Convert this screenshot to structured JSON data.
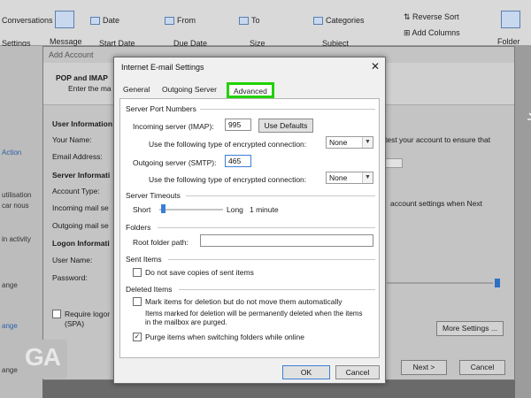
{
  "ribbon": {
    "items": [
      "Conversations",
      "Settings",
      "Message",
      "Date",
      "From",
      "To",
      "Categories",
      "Reverse Sort",
      "Add Columns",
      "Start Date",
      "Due Date",
      "Size",
      "Subject",
      "Folder"
    ]
  },
  "left_pane": {
    "items": [
      "Action",
      "utilisation",
      "car nous",
      "in activity",
      "ange",
      "ange",
      "ange"
    ]
  },
  "add_account": {
    "title": "Add Account",
    "header_title": "POP and IMAP",
    "header_sub": "Enter the ma",
    "user_info": "User Information",
    "your_name": "Your Name:",
    "email": "Email Address:",
    "server_info": "Server Informati",
    "account_type": "Account Type:",
    "incoming": "Incoming mail se",
    "outgoing": "Outgoing mail se",
    "logon_info": "Logon Informati",
    "user_name": "User Name:",
    "password": "Password:",
    "require_logon": "Require logor",
    "spa": "(SPA)",
    "test_text": "test your account to ensure that",
    "settings_text": "account settings when Next",
    "more_settings": "More Settings ...",
    "next": "Next >",
    "cancel": "Cancel"
  },
  "dialog": {
    "title": "Internet E-mail Settings",
    "close": "✕",
    "tabs": [
      "General",
      "Outgoing Server",
      "Advanced"
    ],
    "server_port_numbers": "Server Port Numbers",
    "incoming_label": "Incoming server (IMAP):",
    "incoming_value": "995",
    "use_defaults": "Use Defaults",
    "encrypt_label_1": "Use the following type of encrypted connection:",
    "encrypt_value_1": "None",
    "outgoing_label": "Outgoing server (SMTP):",
    "outgoing_value": "465",
    "encrypt_label_2": "Use the following type of encrypted connection:",
    "encrypt_value_2": "None",
    "server_timeouts": "Server Timeouts",
    "short": "Short",
    "long": "Long",
    "timeout_value": "1 minute",
    "folders": "Folders",
    "root_folder": "Root folder path:",
    "root_folder_value": "",
    "sent_items": "Sent Items",
    "do_not_save": "Do not save copies of sent items",
    "do_not_save_checked": false,
    "deleted_items": "Deleted Items",
    "mark_items": "Mark items for deletion but do not move them automatically",
    "mark_items_checked": false,
    "mark_note": "Items marked for deletion will be permanently deleted when the items in the mailbox are purged.",
    "purge_items": "Purge items when switching folders while online",
    "purge_items_checked": true,
    "ok": "OK",
    "cancel": "Cancel"
  },
  "watermark": {
    "text": "GA"
  },
  "colors": {
    "highlight": "#21d200",
    "accent": "#3c7fd6"
  }
}
